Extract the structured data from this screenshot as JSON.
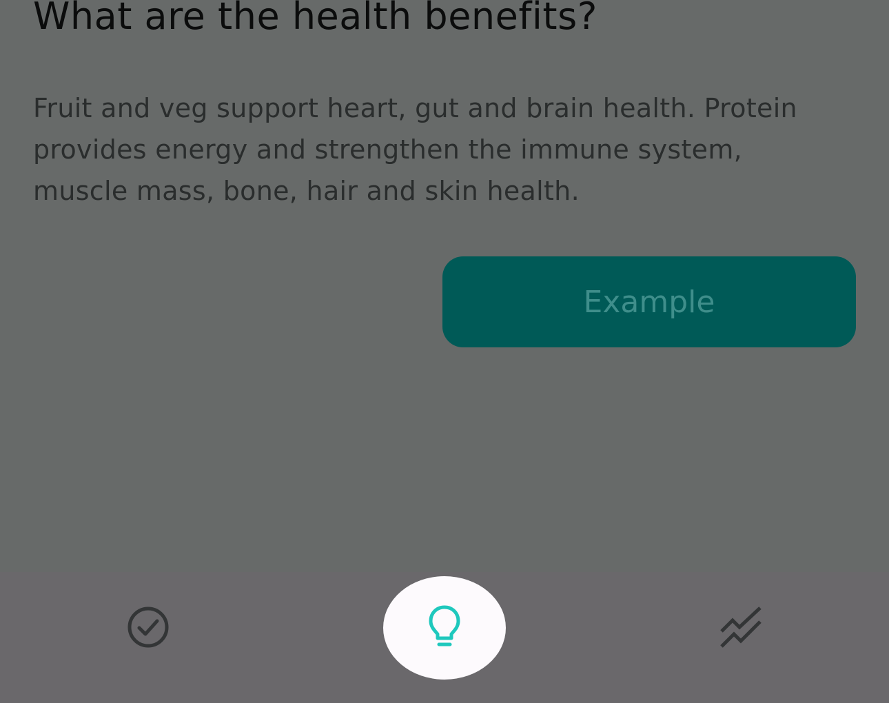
{
  "content": {
    "heading": "What are the health benefits?",
    "body": "Fruit and veg support heart, gut and brain health. Protein provides energy and strengthen the immune system, muscle mass, bone, hair and skin health.",
    "example_button_label": "Example"
  },
  "bottom_nav": {
    "items": [
      {
        "icon": "check-circle-icon",
        "active": false
      },
      {
        "icon": "lightbulb-icon",
        "active": true
      },
      {
        "icon": "trend-chart-icon",
        "active": false
      }
    ]
  },
  "colors": {
    "accent": "#1fc8bd",
    "button_bg": "#005a57",
    "button_text": "#3f8e8b",
    "overlay": "#676a69"
  }
}
